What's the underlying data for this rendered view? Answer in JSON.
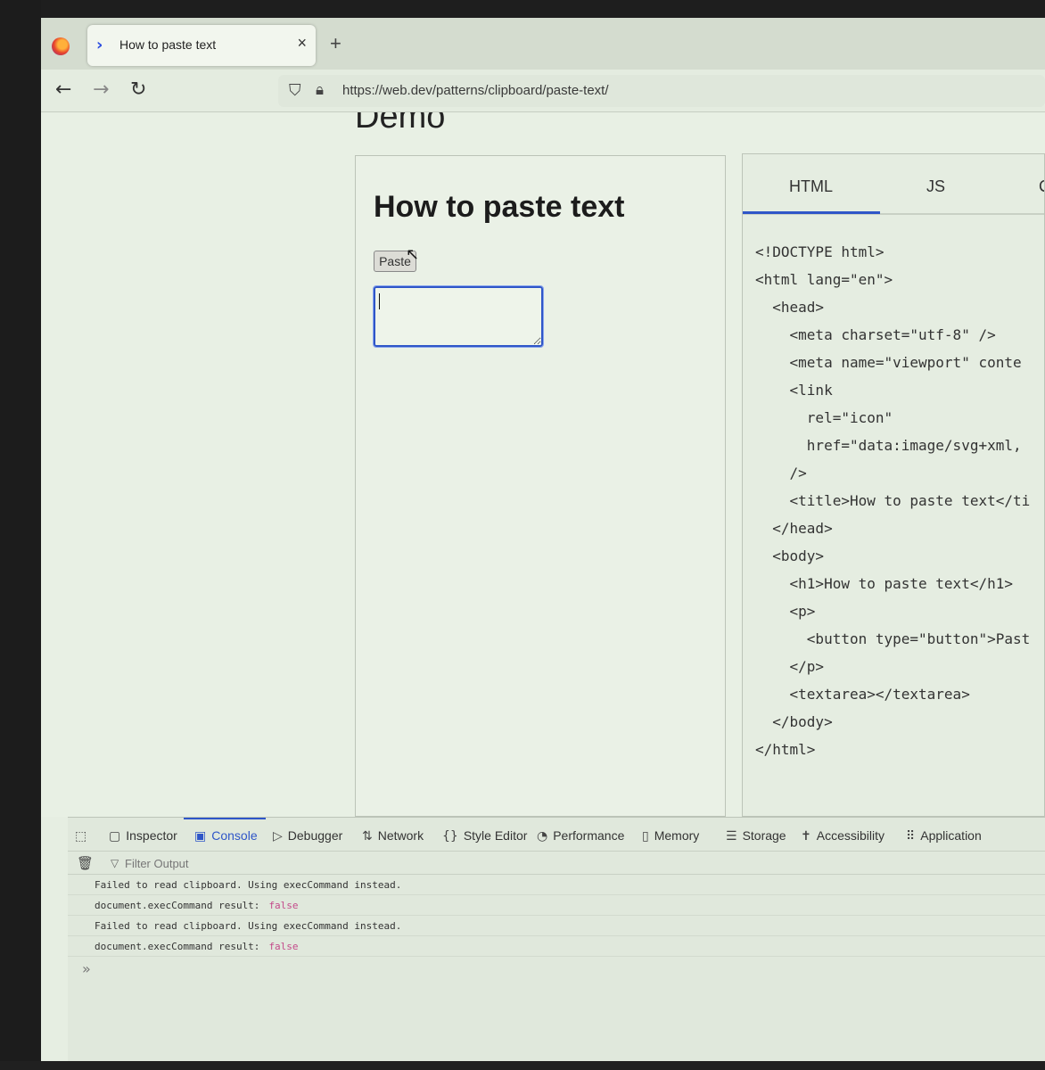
{
  "browser": {
    "tab_title": "How to paste text",
    "tab_close": "×",
    "new_tab": "+",
    "url": "https://web.dev/patterns/clipboard/paste-text/",
    "icons": {
      "back": "arrow-left-icon",
      "forward": "arrow-right-icon",
      "reload": "reload-icon",
      "shield": "shield-icon",
      "lock": "lock-icon"
    }
  },
  "page": {
    "section_heading": "Demo",
    "demo": {
      "heading": "How to paste text",
      "paste_button": "Paste",
      "textarea_value": ""
    },
    "code_tabs": [
      "HTML",
      "JS",
      "C"
    ],
    "code_lines": [
      "<!DOCTYPE html>",
      "<html lang=\"en\">",
      "  <head>",
      "    <meta charset=\"utf-8\" />",
      "    <meta name=\"viewport\" conte",
      "    <link",
      "      rel=\"icon\"",
      "      href=\"data:image/svg+xml,",
      "    />",
      "    <title>How to paste text</ti",
      "  </head>",
      "  <body>",
      "    <h1>How to paste text</h1>",
      "    <p>",
      "      <button type=\"button\">Past",
      "    </p>",
      "    <textarea></textarea>",
      "  </body>",
      "</html>"
    ]
  },
  "devtools": {
    "tabs": [
      {
        "label": "Inspector",
        "icon": "inspector-icon"
      },
      {
        "label": "Console",
        "icon": "console-icon"
      },
      {
        "label": "Debugger",
        "icon": "debugger-icon"
      },
      {
        "label": "Network",
        "icon": "network-icon"
      },
      {
        "label": "Style Editor",
        "icon": "style-editor-icon"
      },
      {
        "label": "Performance",
        "icon": "performance-icon"
      },
      {
        "label": "Memory",
        "icon": "memory-icon"
      },
      {
        "label": "Storage",
        "icon": "storage-icon"
      },
      {
        "label": "Accessibility",
        "icon": "accessibility-icon"
      },
      {
        "label": "Application",
        "icon": "application-icon"
      }
    ],
    "active_tab": "Console",
    "filter_placeholder": "Filter Output",
    "console_messages": [
      {
        "text": "Failed to read clipboard. Using execCommand instead.",
        "value": ""
      },
      {
        "text": "document.execCommand result:",
        "value": "false"
      },
      {
        "text": "Failed to read clipboard. Using execCommand instead.",
        "value": ""
      },
      {
        "text": "document.execCommand result:",
        "value": "false"
      }
    ],
    "prompt": "»"
  },
  "colors": {
    "accent": "#2f56c8",
    "console_value": "#c44a8a"
  }
}
